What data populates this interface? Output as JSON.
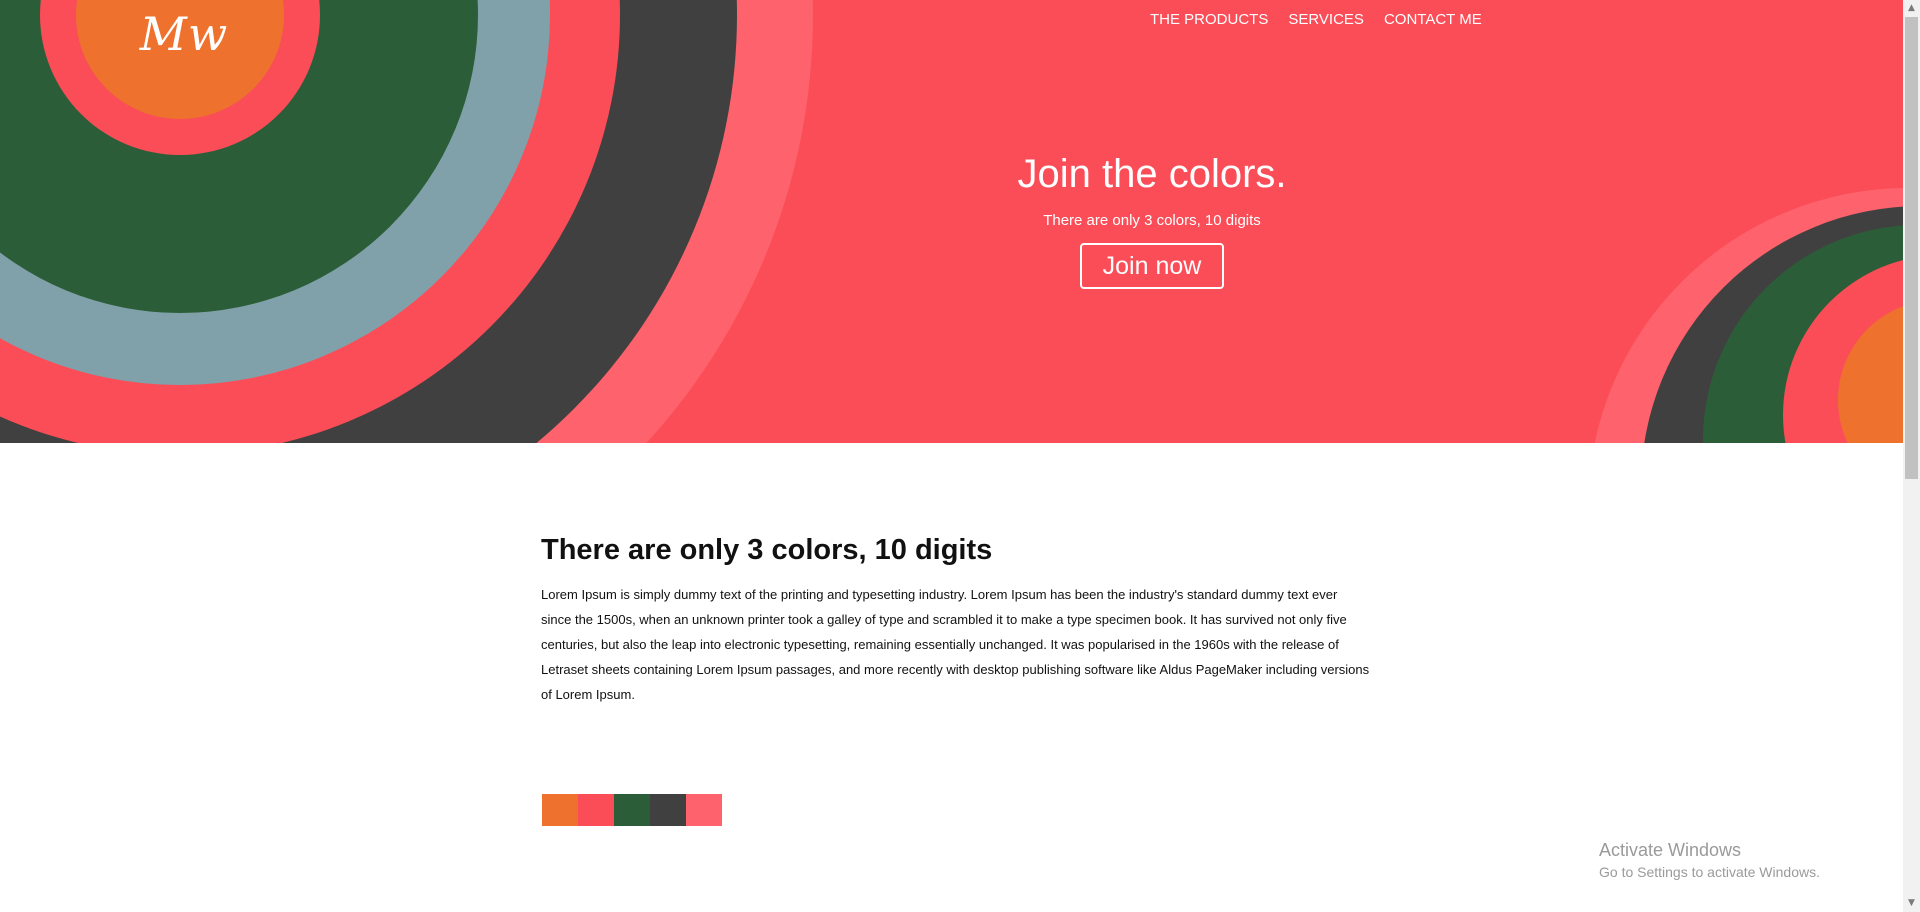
{
  "header": {
    "logo_text": "Mw",
    "nav": [
      {
        "label": "THE PRODUCTS"
      },
      {
        "label": "SERVICES"
      },
      {
        "label": "CONTACT ME"
      }
    ]
  },
  "hero": {
    "title": "Join the colors.",
    "subtitle": "There are only 3 colors, 10 digits",
    "button_label": "Join now"
  },
  "content": {
    "title": "There are only 3 colors, 10 digits",
    "body": "Lorem Ipsum is simply dummy text of the printing and typesetting industry. Lorem Ipsum has been the industry's standard dummy text ever since the 1500s, when an unknown printer took a galley of type and scrambled it to make a type specimen book. It has survived not only five centuries, but also the leap into electronic typesetting, remaining essentially unchanged. It was popularised in the 1960s with the release of Letraset sheets containing Lorem Ipsum passages, and more recently with desktop publishing software like Aldus PageMaker including versions of Lorem Ipsum."
  },
  "palette": {
    "orange": "#ee722e",
    "red": "#fa4d57",
    "green": "#2b5e38",
    "dark": "#404040",
    "pink": "#fe626c",
    "slate": "#81a1aa"
  },
  "watermark": {
    "title": "Activate Windows",
    "subtitle": "Go to Settings to activate Windows."
  }
}
